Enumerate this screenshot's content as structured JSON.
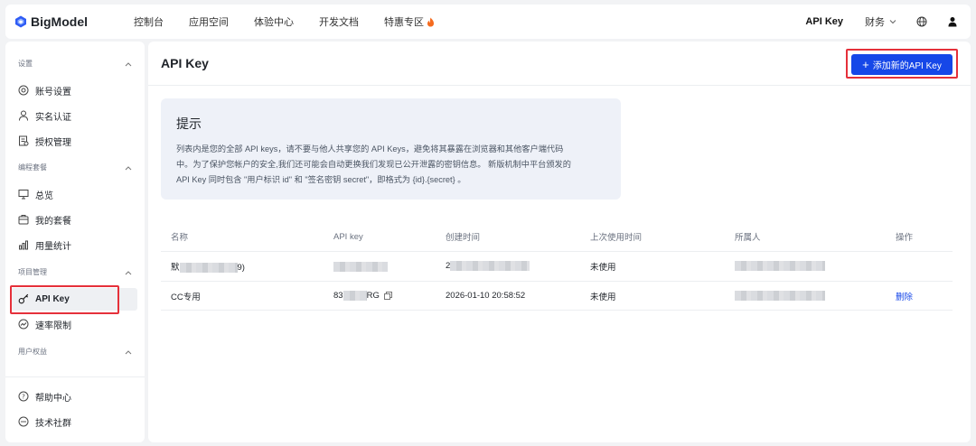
{
  "brand": {
    "name": "BigModel",
    "logo_color": "#2f5cf5"
  },
  "topnav": {
    "items": [
      "控制台",
      "应用空间",
      "体验中心",
      "开发文档",
      "特惠专区"
    ],
    "api_key": "API Key",
    "finance": "财务"
  },
  "sidebar": {
    "sections": [
      {
        "title": "设置",
        "items": [
          {
            "label": "账号设置",
            "icon": "account-settings-icon"
          },
          {
            "label": "实名认证",
            "icon": "user-verify-icon"
          },
          {
            "label": "授权管理",
            "icon": "authorization-icon"
          }
        ]
      },
      {
        "title": "编程套餐",
        "items": [
          {
            "label": "总览",
            "icon": "overview-icon"
          },
          {
            "label": "我的套餐",
            "icon": "package-icon"
          },
          {
            "label": "用量统计",
            "icon": "usage-stats-icon"
          }
        ]
      },
      {
        "title": "项目管理",
        "items": [
          {
            "label": "API Key",
            "icon": "key-icon",
            "active": true
          },
          {
            "label": "速率限制",
            "icon": "rate-limit-icon"
          }
        ]
      },
      {
        "title": "用户权益",
        "items": []
      }
    ],
    "footer": [
      {
        "label": "帮助中心",
        "icon": "help-icon"
      },
      {
        "label": "技术社群",
        "icon": "community-icon"
      }
    ]
  },
  "main": {
    "title": "API Key",
    "add_button": "添加新的API Key",
    "notice": {
      "title": "提示",
      "body_lines": [
        "列表内是您的全部 API keys，请不要与他人共享您的 API Keys，避免将其暴露在浏览器和其他客户端代码",
        "中。为了保护您帐户的安全,我们还可能会自动更换我们发现已公开泄露的密钥信息。 新版机制中平台颁发的",
        "API Key 同时包含 \"用户标识 id\" 和 \"签名密钥 secret\"，即格式为 {id}.{secret} 。"
      ]
    },
    "table": {
      "headers": [
        "名称",
        "API key",
        "创建时间",
        "上次使用时间",
        "所属人",
        "操作"
      ],
      "rows": [
        {
          "name_prefix": "默",
          "name_suffix": "9)",
          "key_prefix": "",
          "key_suffix": "",
          "created_prefix": "2",
          "last_used": "未使用",
          "action": ""
        },
        {
          "name_prefix": "CC专用",
          "name_suffix": "",
          "key_prefix": "83",
          "key_suffix": "RG",
          "created_prefix": "2026-01-10 20:58:52",
          "last_used": "未使用",
          "action": "删除"
        }
      ]
    }
  },
  "colors": {
    "accent": "#1647e8",
    "highlight": "#e5303a"
  }
}
